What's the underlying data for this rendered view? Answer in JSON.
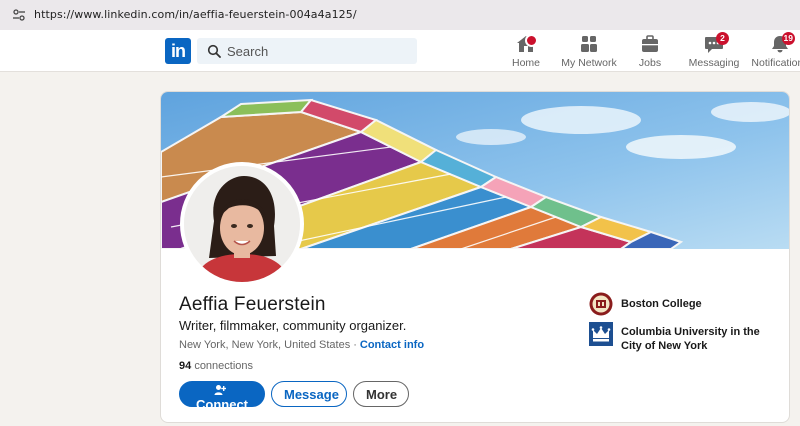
{
  "browser": {
    "url": "https://www.linkedin.com/in/aeffia-feuerstein-004a4a125/"
  },
  "nav": {
    "logo": "in",
    "search_placeholder": "Search",
    "items": [
      {
        "label": "Home",
        "icon": "home-icon",
        "badge": ""
      },
      {
        "label": "My Network",
        "icon": "my-network-icon",
        "badge": ""
      },
      {
        "label": "Jobs",
        "icon": "jobs-icon",
        "badge": ""
      },
      {
        "label": "Messaging",
        "icon": "messaging-icon",
        "badge": "2"
      },
      {
        "label": "Notifications",
        "icon": "notifications-icon",
        "badge": "19"
      }
    ]
  },
  "profile": {
    "name": "Aeffia Feuerstein",
    "headline": "Writer, filmmaker, community organizer.",
    "location": "New York, New York, United States",
    "separator": "·",
    "contact_info": "Contact info",
    "connections_count": "94",
    "connections_label": "connections",
    "buttons": {
      "connect": "Connect",
      "message": "Message",
      "more": "More"
    },
    "education": [
      {
        "name": "Boston College",
        "icon": "boston-college-logo"
      },
      {
        "name": "Columbia University in the City of New York",
        "icon": "columbia-crown-logo"
      }
    ]
  },
  "colors": {
    "brand": "#0a66c2",
    "badge": "#cb112d",
    "page_bg": "#f4f2ee"
  }
}
